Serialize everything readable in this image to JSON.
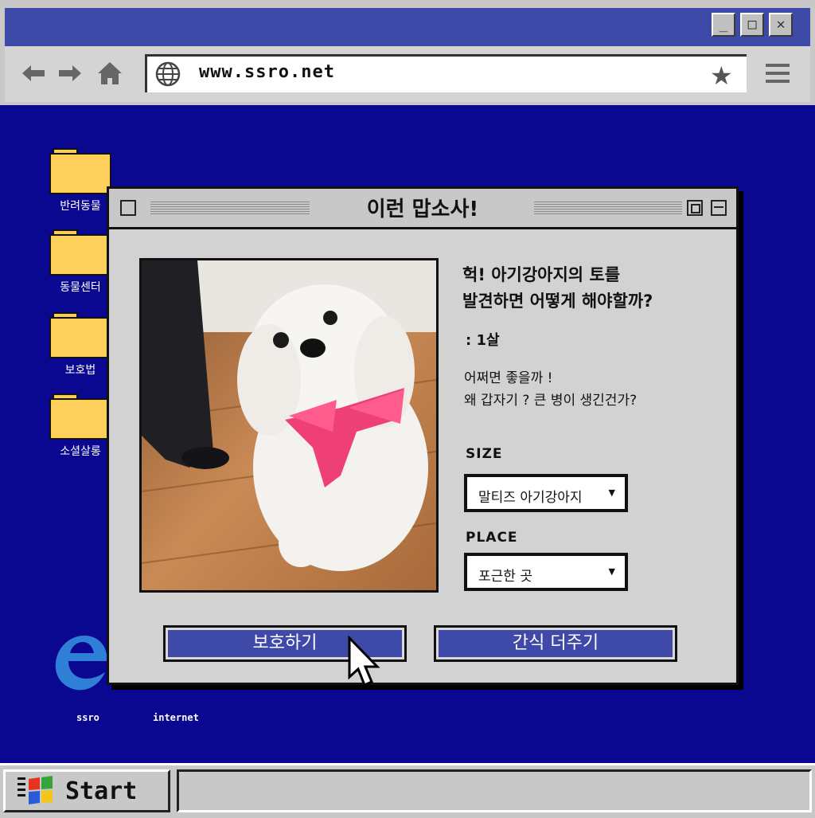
{
  "browser": {
    "url": "www.ssro.net",
    "window_buttons": {
      "minimize": "_",
      "maximize": "□",
      "close": "✕"
    }
  },
  "desktop": {
    "folders": [
      "반려동물",
      "동물센터",
      "보호법",
      "소셜살롱"
    ],
    "bottom_icons": [
      "ssro",
      "internet"
    ]
  },
  "dialog": {
    "title": "이런 맙소사!",
    "heading_line1": "헉! 아기강아지의 토를",
    "heading_line2": "발견하면 어떻게 해야할까?",
    "age": ": 1살",
    "desc_line1": "어쩌면 좋을까 !",
    "desc_line2": "왜 갑자기 ? 큰 병이 생긴건가?",
    "size_label": "SIZE",
    "size_value": "말티즈 아기강아지",
    "place_label": "PLACE",
    "place_value": "포근한 곳",
    "protect_button": "보호하기",
    "snack_button": "간식 더주기"
  },
  "taskbar": {
    "start_label": "Start"
  },
  "colors": {
    "desktop": "#0a0891",
    "titlebar": "#3f49a8",
    "button": "#3f49a8",
    "folder": "#fdcf5b"
  }
}
